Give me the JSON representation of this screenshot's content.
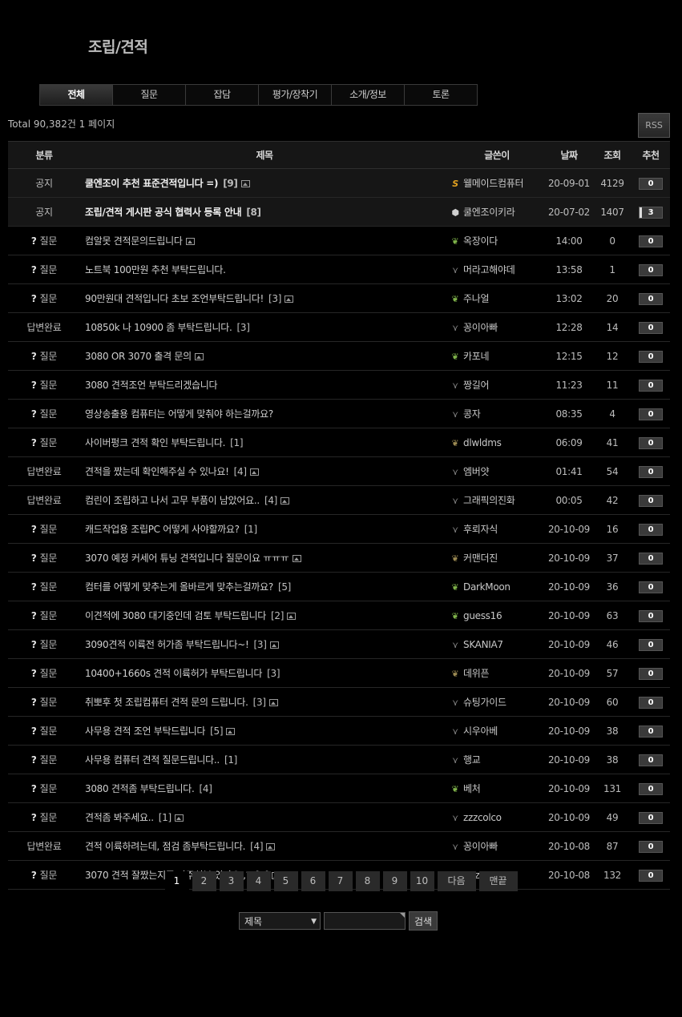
{
  "title": "조립/견적",
  "tabs": [
    "전체",
    "질문",
    "잡담",
    "평가/장착기",
    "소개/정보",
    "토론"
  ],
  "total": "Total 90,382건 1 페이지",
  "rss": "RSS",
  "columns": [
    "분류",
    "제목",
    "글쓴이",
    "날짜",
    "조회",
    "추천"
  ],
  "rows": [
    {
      "notice": true,
      "q": false,
      "cat": "공지",
      "subject": "쿨엔조이 추천 표준견적입니다 =)",
      "comments": "[9]",
      "img": true,
      "icon": "S",
      "icon_name": "level-s-icon",
      "icon_class": "lvs",
      "author": "웰메이드컴퓨터",
      "date": "20-09-01",
      "views": "4129",
      "rec": "0",
      "hot": false
    },
    {
      "notice": true,
      "q": false,
      "cat": "공지",
      "subject": "조립/견적 게시판 공식 협력사 등록 안내",
      "comments": "[8]",
      "img": false,
      "icon": "⬢",
      "icon_name": "cube-icon",
      "icon_class": "cube",
      "author": "쿨엔조이키라",
      "date": "20-07-02",
      "views": "1407",
      "rec": "3",
      "hot": true
    },
    {
      "notice": false,
      "q": true,
      "cat": "질문",
      "subject": "컴알못 견적문의드립니다",
      "comments": "",
      "img": true,
      "icon": "❦",
      "icon_name": "sprout-icon",
      "icon_class": "sprout",
      "author": "옥장이다",
      "date": "14:00",
      "views": "0",
      "rec": "0",
      "hot": false
    },
    {
      "notice": false,
      "q": true,
      "cat": "질문",
      "subject": "노트북 100만원 추천 부탁드립니다.",
      "comments": "",
      "img": false,
      "icon": "⋎",
      "icon_name": "seed-icon",
      "icon_class": "seed",
      "author": "머라고해야데",
      "date": "13:58",
      "views": "1",
      "rec": "0",
      "hot": false
    },
    {
      "notice": false,
      "q": true,
      "cat": "질문",
      "subject": "90만원대 견적입니다 초보 조언부탁드립니다!",
      "comments": "[3]",
      "img": true,
      "icon": "❦",
      "icon_name": "sprout-icon",
      "icon_class": "sprout",
      "author": "주나얼",
      "date": "13:02",
      "views": "20",
      "rec": "0",
      "hot": false
    },
    {
      "notice": false,
      "q": false,
      "cat": "답변완료",
      "subject": "10850k 나 10900 좀 부탁드립니다.",
      "comments": "[3]",
      "img": false,
      "icon": "⋎",
      "icon_name": "seed-icon",
      "icon_class": "seed",
      "author": "꽁이아빠",
      "date": "12:28",
      "views": "14",
      "rec": "0",
      "hot": false
    },
    {
      "notice": false,
      "q": true,
      "cat": "질문",
      "subject": "3080 OR 3070 출격 문의",
      "comments": "",
      "img": true,
      "icon": "❦",
      "icon_name": "sprout-icon",
      "icon_class": "sprout",
      "author": "카포네",
      "date": "12:15",
      "views": "12",
      "rec": "0",
      "hot": false
    },
    {
      "notice": false,
      "q": true,
      "cat": "질문",
      "subject": "3080 견적조언 부탁드리겠습니다",
      "comments": "",
      "img": false,
      "icon": "⋎",
      "icon_name": "seed-icon",
      "icon_class": "seed",
      "author": "짱길어",
      "date": "11:23",
      "views": "11",
      "rec": "0",
      "hot": false
    },
    {
      "notice": false,
      "q": true,
      "cat": "질문",
      "subject": "영상송출용 컴퓨터는 어떻게 맞춰야 하는걸까요?",
      "comments": "",
      "img": false,
      "icon": "⋎",
      "icon_name": "seed-icon",
      "icon_class": "seed",
      "author": "콩자",
      "date": "08:35",
      "views": "4",
      "rec": "0",
      "hot": false
    },
    {
      "notice": false,
      "q": true,
      "cat": "질문",
      "subject": "사이버펑크 견적 확인 부탁드립니다.",
      "comments": "[1]",
      "img": false,
      "icon": "❦",
      "icon_name": "sprout-icon",
      "icon_class": "sprout brown",
      "author": "dlwldms",
      "date": "06:09",
      "views": "41",
      "rec": "0",
      "hot": false
    },
    {
      "notice": false,
      "q": false,
      "cat": "답변완료",
      "subject": "견적을 짰는데 확인해주실 수 있나요!",
      "comments": "[4]",
      "img": true,
      "icon": "⋎",
      "icon_name": "seed-icon",
      "icon_class": "seed",
      "author": "엠버얏",
      "date": "01:41",
      "views": "54",
      "rec": "0",
      "hot": false
    },
    {
      "notice": false,
      "q": false,
      "cat": "답변완료",
      "subject": "컴린이 조립하고 나서 고무 부품이 남았어요..",
      "comments": "[4]",
      "img": true,
      "icon": "⋎",
      "icon_name": "seed-icon",
      "icon_class": "seed",
      "author": "그래픽의진화",
      "date": "00:05",
      "views": "42",
      "rec": "0",
      "hot": false
    },
    {
      "notice": false,
      "q": true,
      "cat": "질문",
      "subject": "캐드작업용 조립PC 어떻게 사야할까요?",
      "comments": "[1]",
      "img": false,
      "icon": "⋎",
      "icon_name": "seed-icon",
      "icon_class": "seed",
      "author": "후뢰자식",
      "date": "20-10-09",
      "views": "16",
      "rec": "0",
      "hot": false
    },
    {
      "notice": false,
      "q": true,
      "cat": "질문",
      "subject": "3070 예정 커세어 튜닝 견적입니다 질문이요 ㅠㅠㅠ",
      "comments": "",
      "img": true,
      "icon": "❦",
      "icon_name": "sprout-icon",
      "icon_class": "sprout brown",
      "author": "커맨더진",
      "date": "20-10-09",
      "views": "37",
      "rec": "0",
      "hot": false
    },
    {
      "notice": false,
      "q": true,
      "cat": "질문",
      "subject": "컴터를 어떻게 맞추는게 올바르게 맞추는걸까요?",
      "comments": "[5]",
      "img": false,
      "icon": "❦",
      "icon_name": "sprout-icon",
      "icon_class": "sprout",
      "author": "DarkMoon",
      "date": "20-10-09",
      "views": "36",
      "rec": "0",
      "hot": false
    },
    {
      "notice": false,
      "q": true,
      "cat": "질문",
      "subject": "이견적에 3080 대기중인데 검토 부탁드립니다",
      "comments": "[2]",
      "img": true,
      "icon": "❦",
      "icon_name": "sprout-icon",
      "icon_class": "sprout",
      "author": "guess16",
      "date": "20-10-09",
      "views": "63",
      "rec": "0",
      "hot": false
    },
    {
      "notice": false,
      "q": true,
      "cat": "질문",
      "subject": "3090견적 이륙전 허가좀 부탁드립니다~!",
      "comments": "[3]",
      "img": true,
      "icon": "⋎",
      "icon_name": "seed-icon",
      "icon_class": "seed",
      "author": "SKANIA7",
      "date": "20-10-09",
      "views": "46",
      "rec": "0",
      "hot": false
    },
    {
      "notice": false,
      "q": true,
      "cat": "질문",
      "subject": "10400+1660s 견적 이륙허가 부탁드립니다",
      "comments": "[3]",
      "img": false,
      "icon": "❦",
      "icon_name": "sprout-icon",
      "icon_class": "sprout brown",
      "author": "데위픈",
      "date": "20-10-09",
      "views": "57",
      "rec": "0",
      "hot": false
    },
    {
      "notice": false,
      "q": true,
      "cat": "질문",
      "subject": "취뽀후 첫 조립컴퓨터 견적 문의 드립니다.",
      "comments": "[3]",
      "img": true,
      "icon": "⋎",
      "icon_name": "seed-icon",
      "icon_class": "seed",
      "author": "슈팅가이드",
      "date": "20-10-09",
      "views": "60",
      "rec": "0",
      "hot": false
    },
    {
      "notice": false,
      "q": true,
      "cat": "질문",
      "subject": "사무용 견적 조언 부탁드립니다",
      "comments": "[5]",
      "img": true,
      "icon": "⋎",
      "icon_name": "seed-icon",
      "icon_class": "seed",
      "author": "시우아베",
      "date": "20-10-09",
      "views": "38",
      "rec": "0",
      "hot": false
    },
    {
      "notice": false,
      "q": true,
      "cat": "질문",
      "subject": "사무용 컴퓨터 견적 질문드립니다..",
      "comments": "[1]",
      "img": false,
      "icon": "⋎",
      "icon_name": "seed-icon",
      "icon_class": "seed",
      "author": "행교",
      "date": "20-10-09",
      "views": "38",
      "rec": "0",
      "hot": false
    },
    {
      "notice": false,
      "q": true,
      "cat": "질문",
      "subject": "3080 견적좀 부탁드립니다.",
      "comments": "[4]",
      "img": false,
      "icon": "❦",
      "icon_name": "sprout-icon",
      "icon_class": "sprout",
      "author": "베처",
      "date": "20-10-09",
      "views": "131",
      "rec": "0",
      "hot": false
    },
    {
      "notice": false,
      "q": true,
      "cat": "질문",
      "subject": "견적좀 봐주세요..",
      "comments": "[1]",
      "img": true,
      "icon": "⋎",
      "icon_name": "seed-icon",
      "icon_class": "seed",
      "author": "zzzcolco",
      "date": "20-10-09",
      "views": "49",
      "rec": "0",
      "hot": false
    },
    {
      "notice": false,
      "q": false,
      "cat": "답변완료",
      "subject": "견적 이륙하려는데, 점검 좀부탁드립니다.",
      "comments": "[4]",
      "img": true,
      "icon": "⋎",
      "icon_name": "seed-icon",
      "icon_class": "seed",
      "author": "꽁이아빠",
      "date": "20-10-08",
      "views": "87",
      "rec": "0",
      "hot": false
    },
    {
      "notice": false,
      "q": true,
      "cat": "질문",
      "subject": "3070 견적 잘짰는지좀 봐주실분 있나요,,?",
      "comments": "[8]",
      "img": true,
      "icon": "⋎",
      "icon_name": "seed-icon",
      "icon_class": "seed",
      "author": "qaz1686",
      "date": "20-10-08",
      "views": "132",
      "rec": "0",
      "hot": false
    }
  ],
  "pager": [
    "1",
    "2",
    "3",
    "4",
    "5",
    "6",
    "7",
    "8",
    "9",
    "10",
    "다음",
    "맨끝"
  ],
  "search": {
    "field": "제목",
    "button": "검색"
  }
}
